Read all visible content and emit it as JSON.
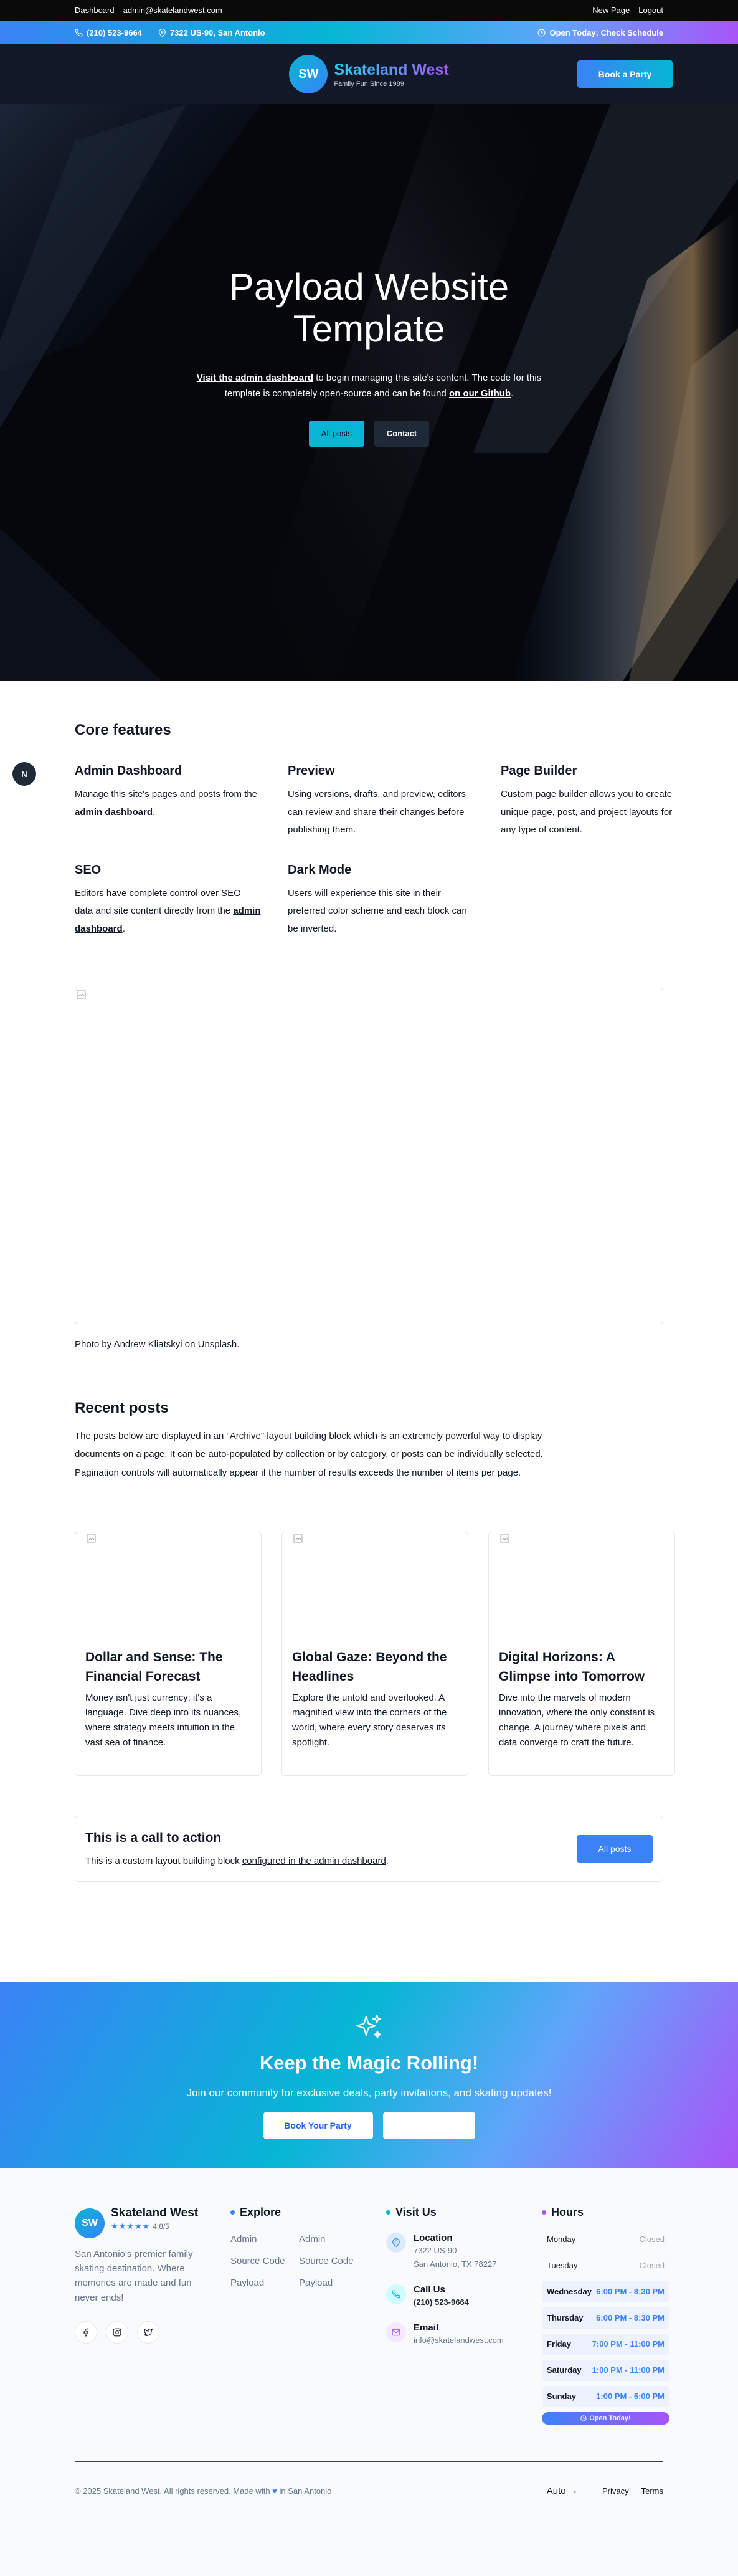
{
  "admin_bar": {
    "dashboard": "Dashboard",
    "email": "admin@skatelandwest.com",
    "new_page": "New Page",
    "logout": "Logout"
  },
  "info_bar": {
    "phone": "(210) 523-9664",
    "address": "7322 US-90, San Antonio",
    "schedule": "Open Today: Check Schedule"
  },
  "header": {
    "logo_initials": "SW",
    "site_name": "Skateland West",
    "tagline": "Family Fun Since 1989",
    "book_button": "Book a Party"
  },
  "hero": {
    "title": "Payload Website Template",
    "text_link_1": "Visit the admin dashboard",
    "text_mid": " to begin managing this site's content. The code for this template is completely open-source and can be found ",
    "text_link_2": "on our Github",
    "text_end": ".",
    "button_posts": "All posts",
    "button_contact": "Contact"
  },
  "features": {
    "title": "Core features",
    "badge": "N",
    "items": [
      {
        "title": "Admin Dashboard",
        "before": "Manage this site's pages and posts from the ",
        "link": "admin dashboard",
        "after": "."
      },
      {
        "title": "Preview",
        "before": "Using versions, drafts, and preview, editors can review and share their changes before publishing them.",
        "link": "",
        "after": ""
      },
      {
        "title": "Page Builder",
        "before": "Custom page builder allows you to create unique page, post, and project layouts for any type of content.",
        "link": "",
        "after": ""
      },
      {
        "title": "SEO",
        "before": "Editors have complete control over SEO data and site content directly from the ",
        "link": "admin dashboard",
        "after": "."
      },
      {
        "title": "Dark Mode",
        "before": "Users will experience this site in their preferred color scheme and each block can be inverted.",
        "link": "",
        "after": ""
      }
    ]
  },
  "media": {
    "caption_before": "Photo by ",
    "caption_link": "Andrew Kliatskyi",
    "caption_after": " on Unsplash."
  },
  "posts": {
    "title": "Recent posts",
    "intro": "The posts below are displayed in an \"Archive\" layout building block which is an extremely powerful way to display documents on a page. It can be auto-populated by collection or by category, or posts can be individually selected. Pagination controls will automatically appear if the number of results exceeds the number of items per page.",
    "cards": [
      {
        "title": "Dollar and Sense: The Financial Forecast",
        "text": "Money isn't just currency; it's a language. Dive deep into its nuances, where strategy meets intuition in the vast sea of finance."
      },
      {
        "title": "Global Gaze: Beyond the Headlines",
        "text": "Explore the untold and overlooked. A magnified view into the corners of the world, where every story deserves its spotlight."
      },
      {
        "title": "Digital Horizons: A Glimpse into Tomorrow",
        "text": "Dive into the marvels of modern innovation, where the only constant is change. A journey where pixels and data converge to craft the future."
      }
    ]
  },
  "cta": {
    "title": "This is a call to action",
    "text_before": "This is a custom layout building block ",
    "text_link": "configured in the admin dashboard",
    "text_after": ".",
    "button": "All posts"
  },
  "magic": {
    "title": "Keep the Magic Rolling!",
    "text": "Join our community for exclusive deals, party invitations, and skating updates!",
    "button_primary": "Book Your Party",
    "button_secondary": ""
  },
  "footer": {
    "brand_initials": "SW",
    "brand_name": "Skateland West",
    "stars": "★★★★★",
    "rating": "4.8/5",
    "description": "San Antonio's premier family skating destination. Where memories are made and fun never ends!",
    "explore_title": "Explore",
    "explore_links": [
      "Admin",
      "Admin",
      "Source Code",
      "Source Code",
      "Payload",
      "Payload"
    ],
    "visit_title": "Visit Us",
    "location_title": "Location",
    "location_line1": "7322 US-90",
    "location_line2": "San Antonio, TX 78227",
    "call_title": "Call Us",
    "call_value": "(210) 523-9664",
    "email_title": "Email",
    "email_value": "info@skatelandwest.com",
    "hours_title": "Hours",
    "hours": [
      {
        "day": "Monday",
        "time": "Closed",
        "open": false
      },
      {
        "day": "Tuesday",
        "time": "Closed",
        "open": false
      },
      {
        "day": "Wednesday",
        "time": "6:00 PM - 8:30 PM",
        "open": true
      },
      {
        "day": "Thursday",
        "time": "6:00 PM - 8:30 PM",
        "open": true
      },
      {
        "day": "Friday",
        "time": "7:00 PM - 11:00 PM",
        "open": true
      },
      {
        "day": "Saturday",
        "time": "1:00 PM - 11:00 PM",
        "open": true
      },
      {
        "day": "Sunday",
        "time": "1:00 PM - 5:00 PM",
        "open": true
      }
    ],
    "open_today": "Open Today!",
    "copyright_before": "© 2025 Skateland West. All rights reserved.  Made with ",
    "copyright_after": " in San Antonio",
    "theme": "Auto",
    "privacy": "Privacy",
    "terms": "Terms"
  },
  "colors": {
    "brand_blue": "#3b82f6",
    "brand_cyan": "#06b6d4",
    "brand_purple": "#a855f7",
    "header_bg": "#111827"
  }
}
